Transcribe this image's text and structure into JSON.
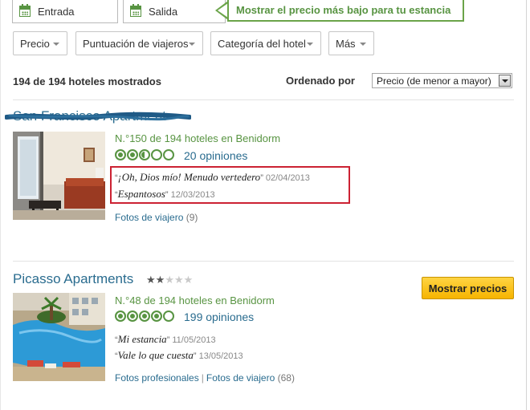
{
  "search": {
    "checkin_placeholder": "Entrada",
    "checkout_placeholder": "Salida",
    "tip": "Mostrar el precio más bajo para tu estancia"
  },
  "filters": [
    {
      "label": "Precio"
    },
    {
      "label": "Puntuación de viajeros"
    },
    {
      "label": "Categoría del hotel"
    },
    {
      "label": "Más"
    }
  ],
  "results": {
    "count_text": "194 de 194 hoteles mostrados",
    "sort_label": "Ordenado por",
    "sort_value": "Precio (de menor a mayor)"
  },
  "hotels": [
    {
      "name": "San Francisco Apartment",
      "rank": "N.°150 de 194 hoteles en Benidorm",
      "rating": 2.5,
      "reviews": "20 opiniones",
      "quotes": [
        {
          "open": "“",
          "text": "¡Oh, Dios mío! Menudo vertedero",
          "close": "”",
          "date": "02/04/2013"
        },
        {
          "open": "“",
          "text": "Espantosos",
          "close": "”",
          "date": "12/03/2013"
        }
      ],
      "photos_traveler": "Fotos de viajero",
      "photos_traveler_count": "(9)"
    },
    {
      "name": "Picasso Apartments",
      "stars": 2,
      "rank": "N.°48 de 194 hoteles en Benidorm",
      "rating": 4,
      "reviews": "199 opiniones",
      "price_button": "Mostrar precios",
      "quotes": [
        {
          "open": "“",
          "text": "Mi estancia",
          "close": "”",
          "date": "11/05/2013"
        },
        {
          "open": "“",
          "text": "Vale lo que cuesta",
          "close": "”",
          "date": "13/05/2013"
        }
      ],
      "photos_pro": "Fotos profesionales",
      "photos_sep": "|",
      "photos_traveler": "Fotos de viajero",
      "photos_traveler_count": "(68)"
    }
  ],
  "colors": {
    "accent_green": "#589442",
    "link_blue": "#2a6c8f",
    "highlight_red": "#cc2233",
    "button_yellow": "#f6b400"
  }
}
